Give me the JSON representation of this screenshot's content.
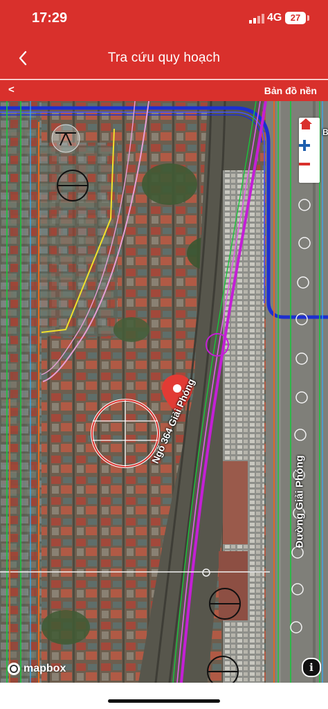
{
  "status_bar": {
    "time": "17:29",
    "network": "4G",
    "battery": "27"
  },
  "header": {
    "title": "Tra cứu quy hoạch",
    "back_icon": "chevron-left-icon"
  },
  "sub_bar": {
    "back_label": "<",
    "basemap_label": "Bản đồ nền"
  },
  "map": {
    "street_labels": [
      "Ngõ 364 Giải Phóng",
      "Đường Giải Phóng"
    ],
    "edge_label": "B",
    "controls": [
      "home-icon",
      "zoom-in-icon",
      "zoom-out-icon"
    ],
    "attribution": "mapbox",
    "info_label": "i"
  },
  "colors": {
    "brand_red": "#d9302c",
    "plan_blue": "#1d2fd0",
    "plan_magenta": "#c41fd6",
    "plan_green": "#19c63b",
    "plan_yellow": "#f2e22a",
    "plan_orange": "#e8661c"
  }
}
